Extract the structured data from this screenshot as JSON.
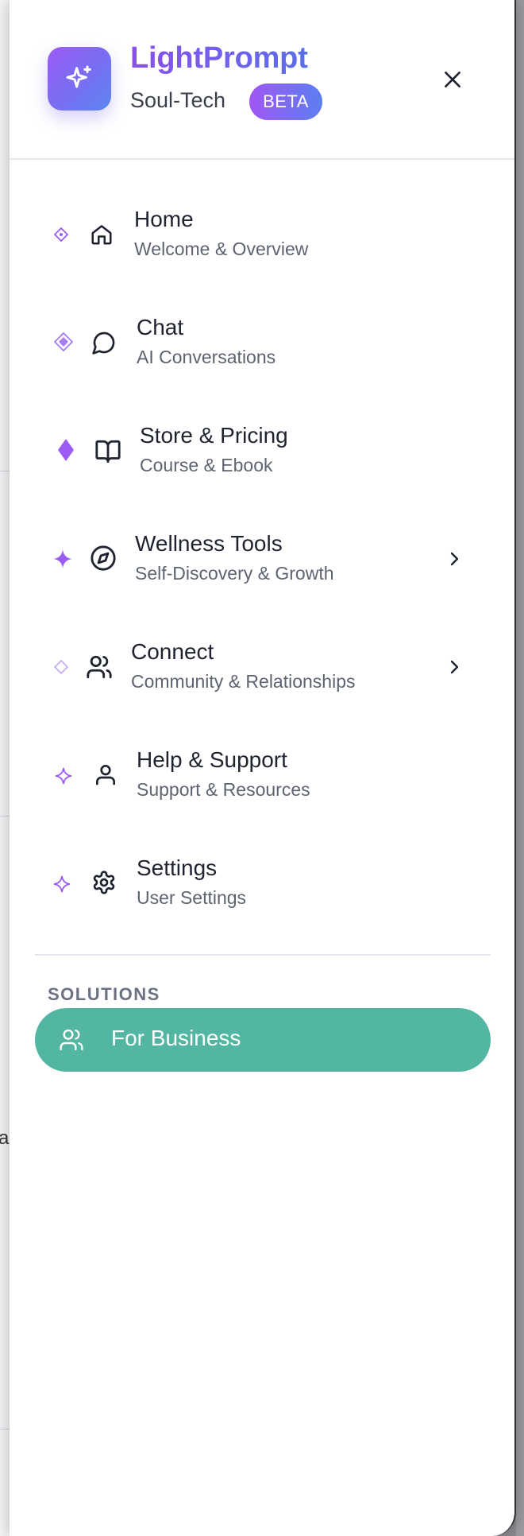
{
  "brand": {
    "name": "LightPrompt",
    "subtitle": "Soul-Tech",
    "badge": "BETA"
  },
  "close_icon": "close-icon",
  "nav": [
    {
      "label": "Home",
      "description": "Welcome & Overview",
      "icon": "home-icon",
      "has_submenu": false
    },
    {
      "label": "Chat",
      "description": "AI Conversations",
      "icon": "chat-bubble-icon",
      "has_submenu": false
    },
    {
      "label": "Store & Pricing",
      "description": "Course & Ebook",
      "icon": "book-open-icon",
      "has_submenu": false
    },
    {
      "label": "Wellness Tools",
      "description": "Self-Discovery & Growth",
      "icon": "compass-icon",
      "has_submenu": true
    },
    {
      "label": "Connect",
      "description": "Community & Relationships",
      "icon": "users-icon",
      "has_submenu": true
    },
    {
      "label": "Help & Support",
      "description": "Support & Resources",
      "icon": "user-icon",
      "has_submenu": false
    },
    {
      "label": "Settings",
      "description": "User Settings",
      "icon": "gear-icon",
      "has_submenu": false
    }
  ],
  "solutions": {
    "heading": "SOLUTIONS",
    "business_label": "For Business",
    "business_icon": "users-icon"
  },
  "background_page": {
    "letter": "a"
  },
  "colors": {
    "accent_purple": "#9b5cf4",
    "accent_blue": "#5b86f0",
    "business_green": "#52b6a2"
  }
}
